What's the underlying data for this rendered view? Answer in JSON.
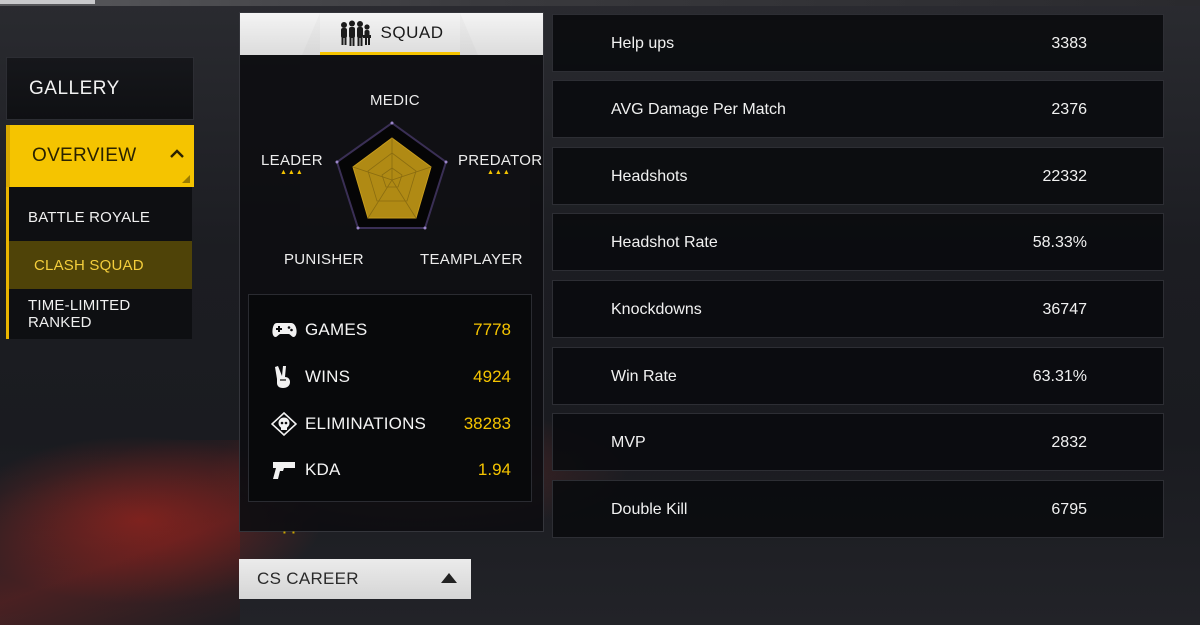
{
  "nav": {
    "gallery": "GALLERY",
    "overview": "OVERVIEW",
    "sub_items": [
      "BATTLE ROYALE",
      "CLASH SQUAD",
      "TIME-LIMITED RANKED"
    ],
    "active_sub": 1
  },
  "squad": {
    "tab_label": "SQUAD",
    "radar_labels": {
      "top": "MEDIC",
      "left": "LEADER",
      "right": "PREDATOR",
      "bottom_left": "PUNISHER",
      "bottom_right": "TEAMPLAYER"
    },
    "stats": [
      {
        "icon": "gamepad-icon",
        "label": "GAMES",
        "value": "7778"
      },
      {
        "icon": "victory-hand-icon",
        "label": "WINS",
        "value": "4924"
      },
      {
        "icon": "skull-target-icon",
        "label": "ELIMINATIONS",
        "value": "38283"
      },
      {
        "icon": "pistol-icon",
        "label": "KDA",
        "value": "1.94"
      }
    ]
  },
  "career": {
    "label": "CS CAREER"
  },
  "detail_stats": [
    {
      "label": "Help ups",
      "value": "3383"
    },
    {
      "label": "AVG Damage Per Match",
      "value": "2376"
    },
    {
      "label": "Headshots",
      "value": "22332"
    },
    {
      "label": "Headshot Rate",
      "value": "58.33%"
    },
    {
      "label": "Knockdowns",
      "value": "36747"
    },
    {
      "label": "Win Rate",
      "value": "63.31%"
    },
    {
      "label": "MVP",
      "value": "2832"
    },
    {
      "label": "Double Kill",
      "value": "6795"
    }
  ],
  "colors": {
    "accent": "#f5c400",
    "radar_fill": "#b08a14"
  }
}
